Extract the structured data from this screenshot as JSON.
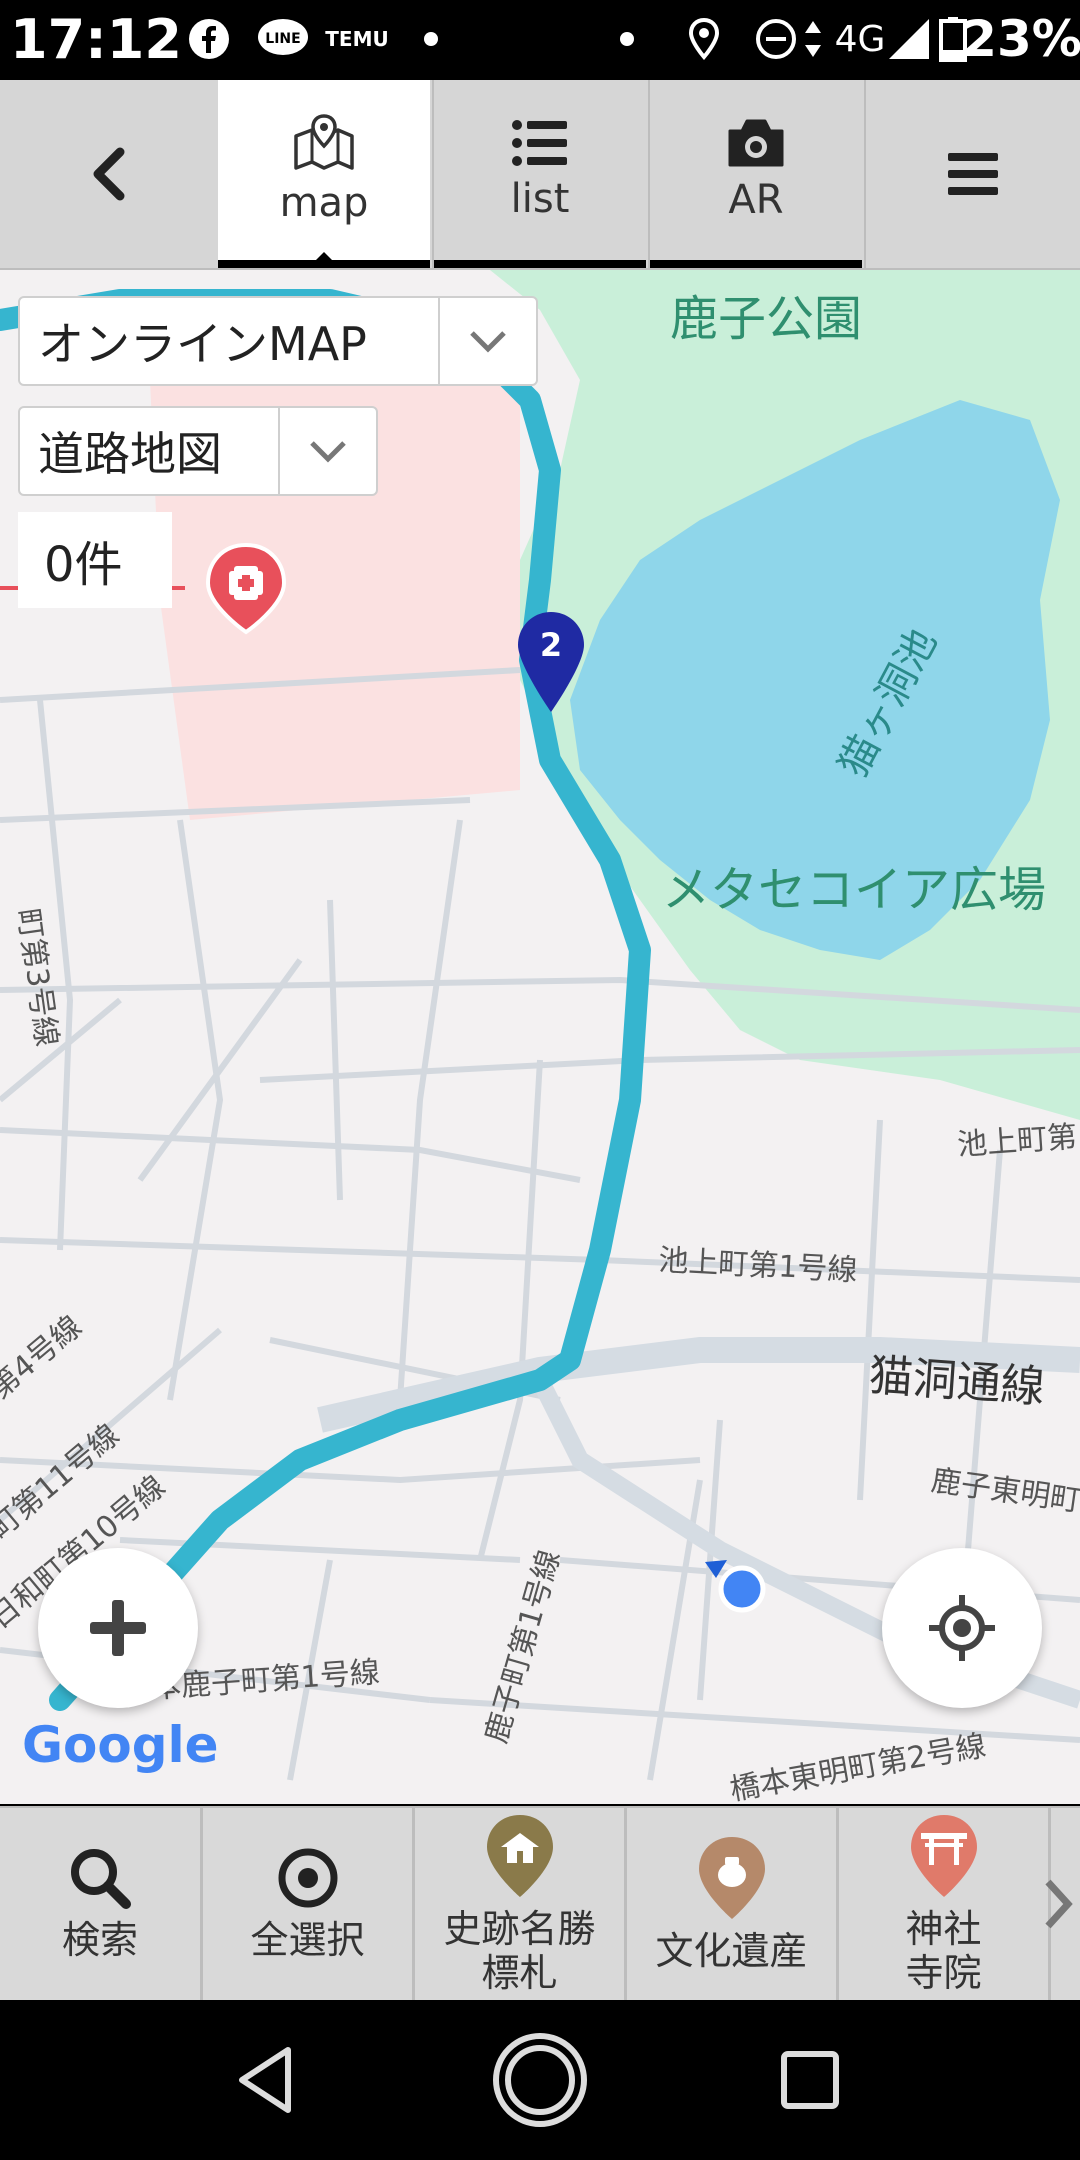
{
  "status_bar": {
    "time": "17:12",
    "network": "4G",
    "battery": "23%",
    "icons": [
      "facebook-icon",
      "line-icon",
      "temu-icon",
      "dot-icon",
      "location-icon",
      "dnd-icon",
      "signal-icon",
      "battery-icon"
    ],
    "temu_text": "TEMU",
    "line_text": "LINE"
  },
  "tabs": [
    {
      "label": "map",
      "icon": "map-icon",
      "active": true
    },
    {
      "label": "list",
      "icon": "list-icon",
      "active": false
    },
    {
      "label": "AR",
      "icon": "camera-icon",
      "active": false
    }
  ],
  "map": {
    "source_select": "オンラインMAP",
    "map_type_select": "道路地図",
    "result_count": "0件",
    "marker_number": "2",
    "google_logo": "Google",
    "labels": {
      "park": "鹿子公園",
      "pond": "猫ヶ洞池",
      "plaza": "メタセコイア広場",
      "avenue": "猫洞通線",
      "ikegami1": "池上町第1号線",
      "ikegami_partial": "池上町第",
      "kanoko_higashi": "鹿子東明町",
      "hashimoto_kanoko": "橋本鹿子町第1号線",
      "kanoko1": "鹿子町第1号線",
      "hashimoto_higashi2": "橋本東明町第2号線",
      "route11": "町第11号線",
      "route10": "日和町第10号線",
      "route4": "第4号線",
      "route3": "町第3号線"
    },
    "colors": {
      "route": "#36b5cf",
      "water": "#8fd6ea",
      "park": "#c9efd9",
      "hospital_area": "#fbe1e1",
      "marker": "#1f2aa3",
      "location_dot": "#4285f4",
      "park_text": "#2f8f6f"
    }
  },
  "categories": [
    {
      "label": "検索",
      "icon": "search-icon"
    },
    {
      "label": "全選択",
      "icon": "target-icon"
    },
    {
      "label": "史跡名勝\n標札",
      "icon": "historic-site-icon",
      "color": "#8a7a4a"
    },
    {
      "label": "文化遺産",
      "icon": "cultural-heritage-icon",
      "color": "#b5896a"
    },
    {
      "label": "神社\n寺院",
      "icon": "shrine-icon",
      "color": "#e07a6a"
    }
  ]
}
